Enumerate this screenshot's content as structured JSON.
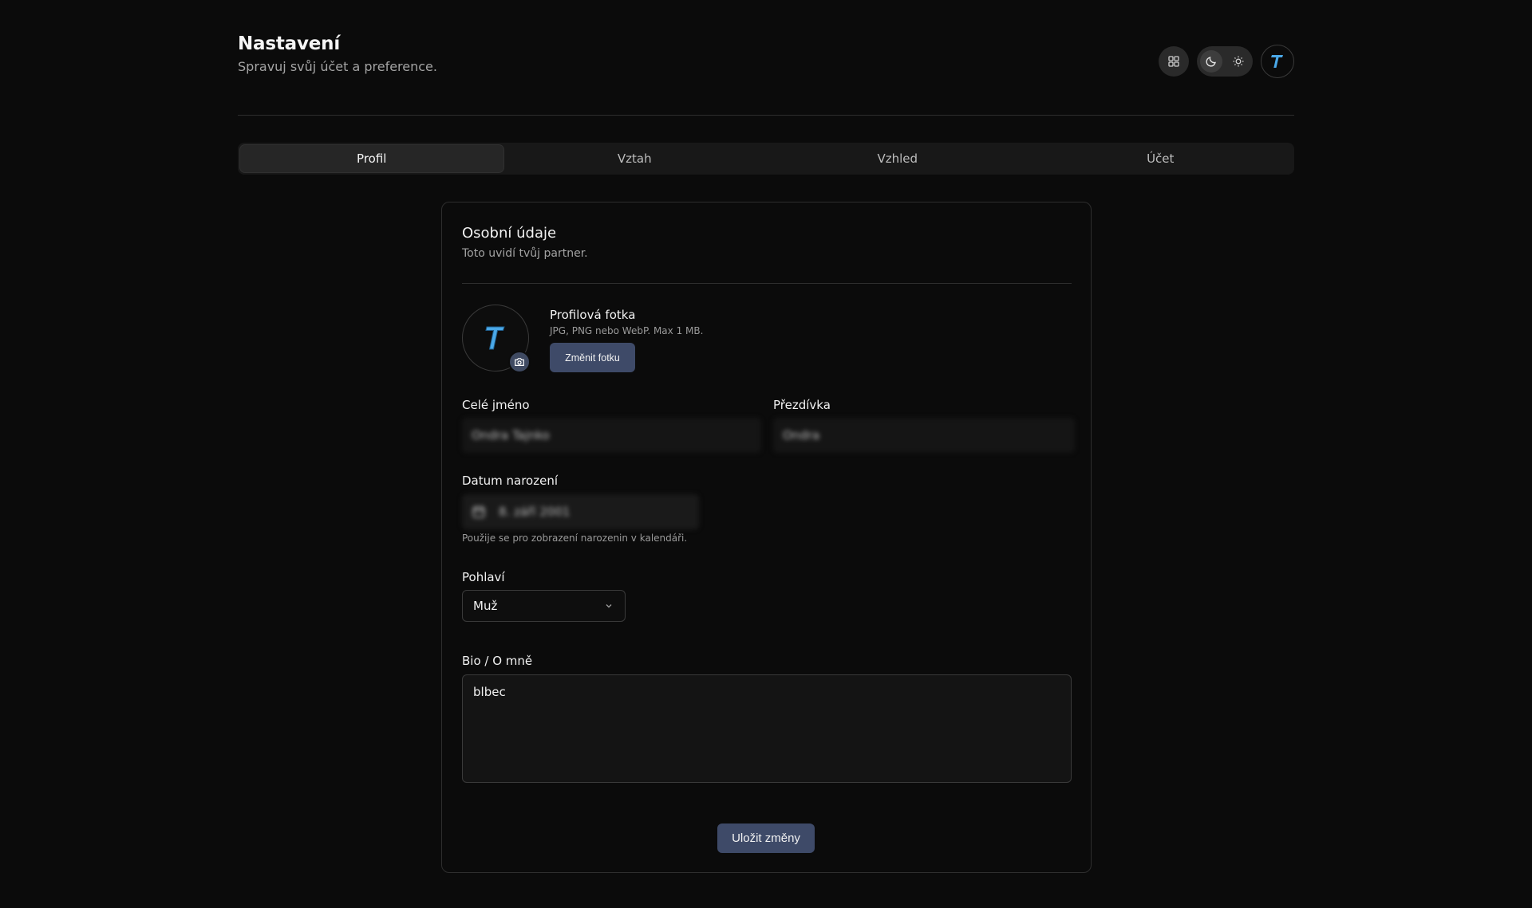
{
  "header": {
    "title": "Nastavení",
    "subtitle": "Spravuj svůj účet a preference."
  },
  "tabs": [
    {
      "label": "Profil",
      "active": true
    },
    {
      "label": "Vztah",
      "active": false
    },
    {
      "label": "Vzhled",
      "active": false
    },
    {
      "label": "Účet",
      "active": false
    }
  ],
  "card": {
    "title": "Osobní údaje",
    "description": "Toto uvidí tvůj partner.",
    "photo": {
      "label": "Profilová fotka",
      "hint": "JPG, PNG nebo WebP. Max 1 MB.",
      "button": "Změnit fotku"
    },
    "full_name": {
      "label": "Celé jméno",
      "value": "Ondra Tajnko"
    },
    "nickname": {
      "label": "Přezdívka",
      "value": "Ondra"
    },
    "birth_date": {
      "label": "Datum narození",
      "value": "8. září 2001",
      "hint": "Použije se pro zobrazení narozenin v kalendáři."
    },
    "gender": {
      "label": "Pohlaví",
      "value": "Muž"
    },
    "bio": {
      "label": "Bio / O mně",
      "value": "blbec"
    },
    "save_button": "Uložit změny"
  },
  "colors": {
    "background": "#0b0b0b",
    "primary_button": "#3e4a68",
    "logo_accent": "#4aa8e8"
  },
  "icons": {
    "grid": "grid-icon",
    "theme_dark": "moon-icon",
    "theme_light": "sun-icon",
    "camera": "camera-icon",
    "calendar": "calendar-icon",
    "chevron": "chevron-down-icon"
  }
}
